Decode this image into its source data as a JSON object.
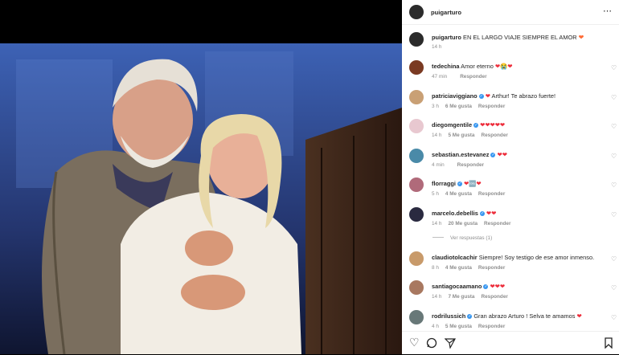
{
  "post": {
    "author": "puigarturo",
    "caption": "EN EL LARGO VIAJE SIEMPRE EL AMOR",
    "caption_emoji": "❤",
    "caption_time": "14 h"
  },
  "icons": {
    "more": "more-icon",
    "like": "heart-icon",
    "comment": "comment-icon",
    "share": "share-icon",
    "save": "bookmark-icon"
  },
  "comments": [
    {
      "user": "tedechina",
      "verified": false,
      "text": "Amor eterno ❤😭❤",
      "time": "47 min",
      "likes": "",
      "reply": "Responder",
      "avatar": "#7a3a22"
    },
    {
      "user": "patriciaviggiano",
      "verified": true,
      "text": "❤ Arthur! Te abrazo fuerte!",
      "time": "3 h",
      "likes": "6 Me gusta",
      "reply": "Responder",
      "avatar": "#c9a075"
    },
    {
      "user": "diegomgentile",
      "verified": true,
      "text": "❤❤❤❤❤",
      "time": "14 h",
      "likes": "5 Me gusta",
      "reply": "Responder",
      "avatar": "#e8c8d0"
    },
    {
      "user": "sebastian.estevanez",
      "verified": true,
      "text": "❤❤",
      "time": "4 min",
      "likes": "",
      "reply": "Responder",
      "avatar": "#4a8aa8"
    },
    {
      "user": "florraggi",
      "verified": true,
      "text": "❤🆒❤",
      "time": "5 h",
      "likes": "4 Me gusta",
      "reply": "Responder",
      "avatar": "#b06a7a"
    },
    {
      "user": "marcelo.debellis",
      "verified": true,
      "text": "❤❤",
      "time": "14 h",
      "likes": "20 Me gusta",
      "reply": "Responder",
      "avatar": "#2a2a40"
    },
    {
      "user": "claudiotolcachir",
      "verified": false,
      "text": "Siempre! Soy testigo de ese amor inmenso.",
      "time": "8 h",
      "likes": "4 Me gusta",
      "reply": "Responder",
      "avatar": "#c89a6a"
    },
    {
      "user": "santiagocaamano",
      "verified": true,
      "text": "❤❤❤",
      "time": "14 h",
      "likes": "7 Me gusta",
      "reply": "Responder",
      "avatar": "#a87860"
    },
    {
      "user": "rodrilussich",
      "verified": true,
      "text": "Gran abrazo Arturo ! Selva te amamos ❤",
      "time": "4 h",
      "likes": "5 Me gusta",
      "reply": "Responder",
      "avatar": "#687878"
    }
  ],
  "replies_toggle": "Ver respuestas (1)"
}
